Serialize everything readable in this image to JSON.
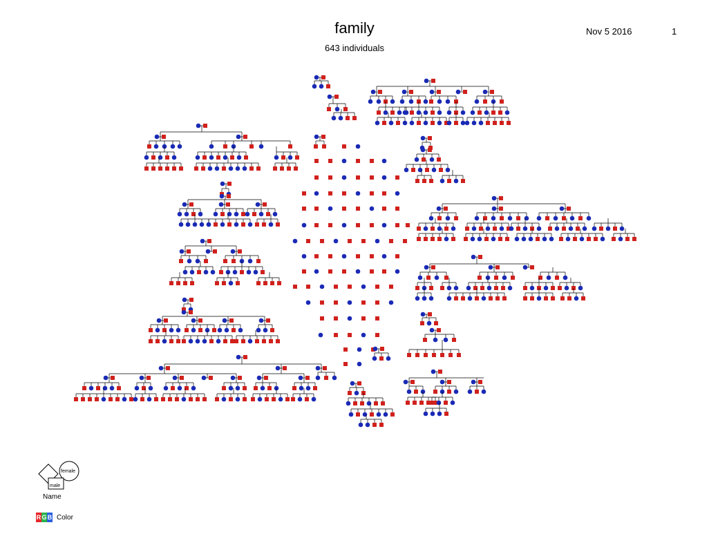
{
  "header": {
    "title": "family",
    "subtitle": "643 individuals",
    "date": "Nov  5 2016",
    "page_number": "1"
  },
  "legend": {
    "name_label": "Name",
    "female_label": "female",
    "male_label": "male",
    "color_label": "Color",
    "rgb_letters": [
      "R",
      "G",
      "B"
    ],
    "rgb_colors": [
      "#e8262a",
      "#2bb34a",
      "#2a5fe0"
    ]
  },
  "colors": {
    "male": "#d0211d",
    "female": "#1a2ab5",
    "line": "#000000"
  }
}
